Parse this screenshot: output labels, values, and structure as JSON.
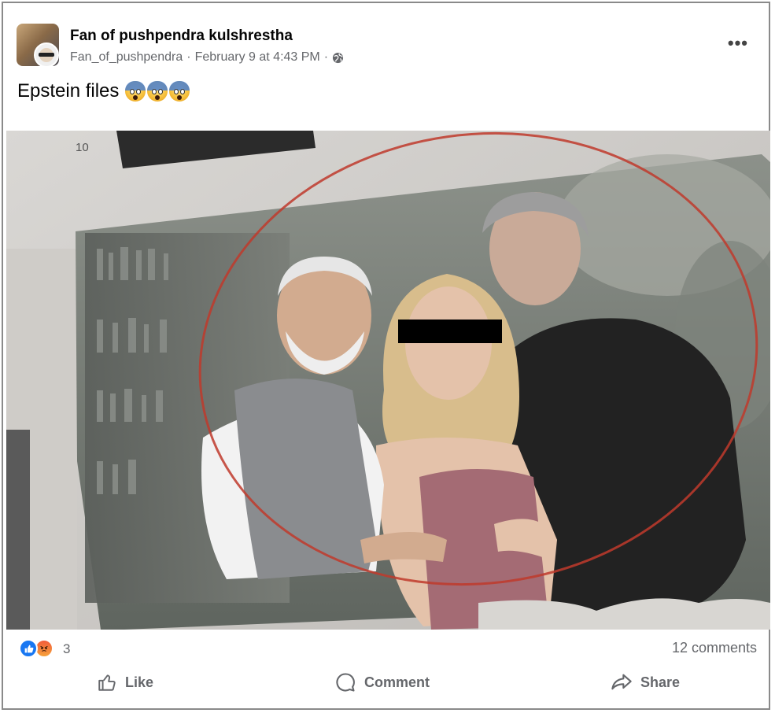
{
  "post": {
    "author": "Fan of pushpendra kulshrestha",
    "handle": "Fan_of_pushpendra",
    "separator": "·",
    "timestamp": "February 9 at 4:43 PM",
    "separator2": "·",
    "privacy_icon": "globe-icon",
    "more_icon": "more-options-icon",
    "more_glyph": "•••",
    "text": "Epstein files",
    "emojis": [
      "face-screaming-in-fear",
      "face-screaming-in-fear",
      "face-screaming-in-fear"
    ]
  },
  "photo": {
    "page_number": "10",
    "description_icon": "post-photo",
    "accent_circle_color": "#c0392b",
    "censor_bar_color": "#000000"
  },
  "reactions": {
    "icons": [
      "like-reaction-icon",
      "angry-reaction-icon"
    ],
    "count": "3",
    "comments": "12 comments"
  },
  "actions": {
    "like": "Like",
    "comment": "Comment",
    "share": "Share"
  },
  "colors": {
    "text_primary": "#050505",
    "text_secondary": "#65676b",
    "like_blue": "#1877f2"
  }
}
